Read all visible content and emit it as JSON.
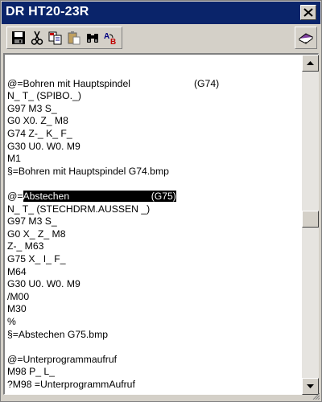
{
  "window": {
    "title": "DR HT20-23R"
  },
  "toolbar": {
    "buttons": [
      {
        "name": "save",
        "icon": "floppy-disk-icon"
      },
      {
        "name": "cut",
        "icon": "scissors-icon"
      },
      {
        "name": "copy",
        "icon": "copy-icon"
      },
      {
        "name": "paste",
        "icon": "paste-icon"
      },
      {
        "name": "find",
        "icon": "binoculars-icon"
      },
      {
        "name": "replace",
        "icon": "find-replace-icon"
      }
    ],
    "replace_label_a": "A",
    "replace_label_b": "B",
    "book_icon": "book-icon"
  },
  "editor": {
    "lines": [
      {
        "left": "",
        "right": ""
      },
      {
        "left": "@=Bohren mit Hauptspindel",
        "right": "(G74)"
      },
      {
        "left": "N_ T_ (SPIBO._)",
        "right": ""
      },
      {
        "left": "G97 M3 S_",
        "right": ""
      },
      {
        "left": "G0 X0. Z_ M8",
        "right": ""
      },
      {
        "left": "G74 Z-_ K_ F_",
        "right": ""
      },
      {
        "left": "G30 U0. W0. M9",
        "right": ""
      },
      {
        "left": "M1",
        "right": ""
      },
      {
        "left": "§=Bohren mit Hauptspindel G74.bmp",
        "right": ""
      },
      {
        "left": "",
        "right": ""
      },
      {
        "left": "@=Abstechen",
        "right": "(G75)",
        "selected": true
      },
      {
        "left": "N_ T_ (STECHDRM.AUSSEN _)",
        "right": ""
      },
      {
        "left": "G97 M3 S_",
        "right": ""
      },
      {
        "left": "G0 X_ Z_ M8",
        "right": ""
      },
      {
        "left": "Z-_ M63",
        "right": ""
      },
      {
        "left": "G75 X_ I_ F_",
        "right": ""
      },
      {
        "left": "M64",
        "right": ""
      },
      {
        "left": "G30 U0. W0. M9",
        "right": ""
      },
      {
        "left": "/M00",
        "right": ""
      },
      {
        "left": "M30",
        "right": ""
      },
      {
        "left": "%",
        "right": ""
      },
      {
        "left": "§=Abstechen G75.bmp",
        "right": ""
      },
      {
        "left": "",
        "right": ""
      },
      {
        "left": "@=Unterprogrammaufruf",
        "right": ""
      },
      {
        "left": "M98 P_ L_",
        "right": ""
      },
      {
        "left": "?M98 =UnterprogrammAufruf",
        "right": ""
      }
    ],
    "selection": {
      "prefix": "@=",
      "text": "Abstechen",
      "pad": "                              ",
      "right": "(G75)"
    }
  },
  "scrollbar": {
    "position_fraction": 0.48
  },
  "colors": {
    "titlebar": "#0a246a",
    "face": "#d4d0c8",
    "selection": "#000000"
  }
}
